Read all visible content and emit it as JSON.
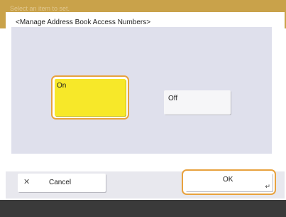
{
  "backdrop": {
    "text": "Select an item to set."
  },
  "dialog": {
    "title": "<Manage Address Book Access Numbers>"
  },
  "options": {
    "on_label": "On",
    "off_label": "Off",
    "selected": "On"
  },
  "footer": {
    "cancel_label": "Cancel",
    "ok_label": "OK"
  },
  "icons": {
    "cancel": "close-icon",
    "ok": "enter-icon"
  },
  "colors": {
    "selected_fill": "#f7e829",
    "focus_border": "#e8a23e",
    "panel_bg": "#dfe0ec"
  }
}
